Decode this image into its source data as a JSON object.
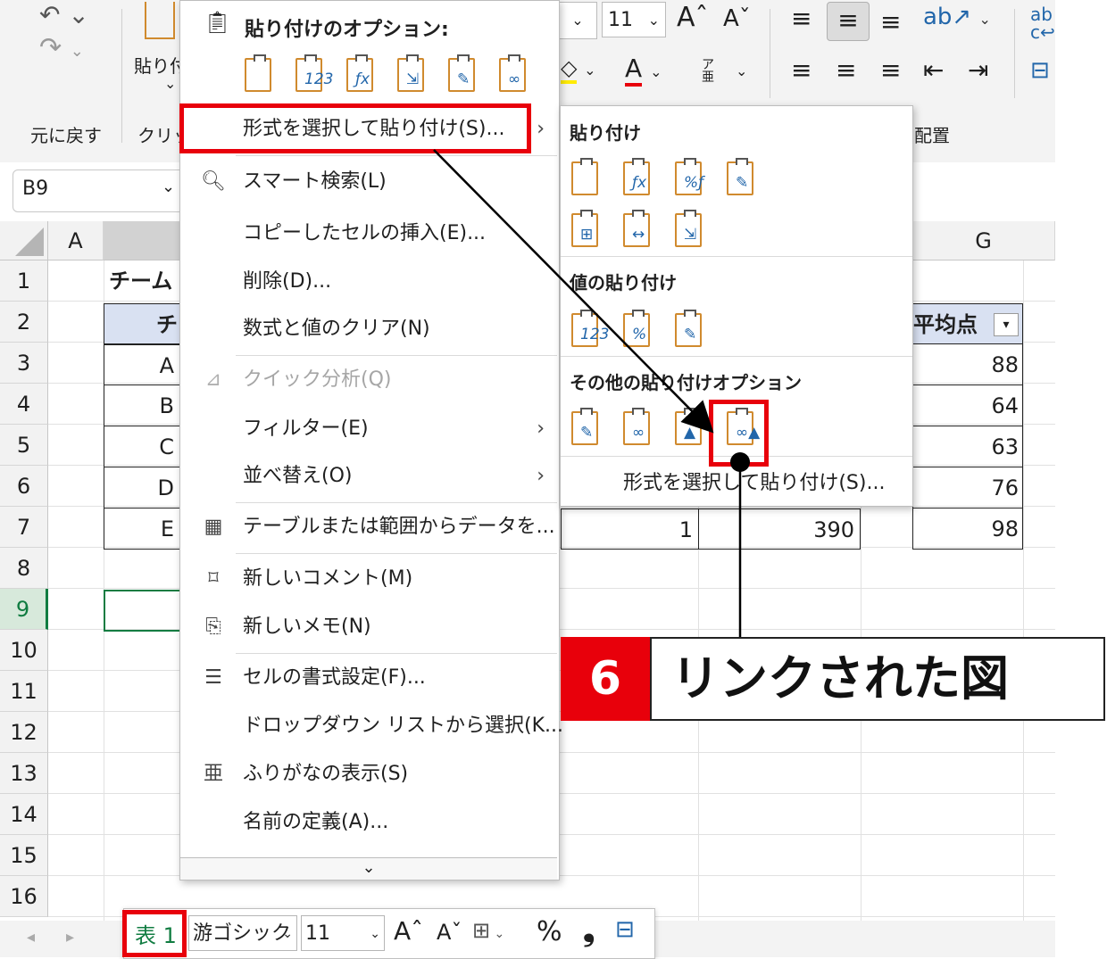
{
  "ribbon": {
    "undo_label": "元に戻す",
    "clipboard_label": "クリッ",
    "paste_partial": "貼り付",
    "font_size": "11",
    "align_label": "配置"
  },
  "namebox": {
    "value": "B9"
  },
  "columns": [
    "A",
    "G"
  ],
  "rows": [
    "1",
    "2",
    "3",
    "4",
    "5",
    "6",
    "7",
    "8",
    "9",
    "10",
    "11",
    "12",
    "13",
    "14",
    "15",
    "16"
  ],
  "sheet": {
    "title_partial": "チーム",
    "header_partial": "チ",
    "header_g": "平均点",
    "teams": [
      "A",
      "B",
      "C",
      "D",
      "E"
    ],
    "g_values": [
      "88",
      "64",
      "63",
      "76",
      "98"
    ],
    "row7_e": "1",
    "row7_f": "390"
  },
  "context_menu": {
    "paste_options_title": "貼り付けのオプション:",
    "items": [
      {
        "label": "形式を選択して貼り付け(S)...",
        "icon": "",
        "submenu": true
      },
      {
        "label": "スマート検索(L)",
        "icon": "search-info-icon"
      },
      {
        "label": "コピーしたセルの挿入(E)..."
      },
      {
        "label": "削除(D)..."
      },
      {
        "label": "数式と値のクリア(N)"
      },
      {
        "label": "クイック分析(Q)",
        "icon": "quick-analysis-icon",
        "disabled": true
      },
      {
        "label": "フィルター(E)",
        "submenu": true
      },
      {
        "label": "並べ替え(O)",
        "submenu": true
      },
      {
        "label": "テーブルまたは範囲からデータを...",
        "icon": "table-icon"
      },
      {
        "label": "新しいコメント(M)",
        "icon": "new-comment-icon"
      },
      {
        "label": "新しいメモ(N)",
        "icon": "new-note-icon"
      },
      {
        "label": "セルの書式設定(F)...",
        "icon": "format-cells-icon"
      },
      {
        "label": "ドロップダウン リストから選択(K..."
      },
      {
        "label": "ふりがなの表示(S)",
        "icon": "furigana-icon"
      },
      {
        "label": "名前の定義(A)..."
      }
    ],
    "more_glyph": "⌄"
  },
  "submenu": {
    "paste_title": "貼り付け",
    "values_title": "値の貼り付け",
    "other_title": "その他の貼り付けオプション",
    "footer": "形式を選択して貼り付け(S)..."
  },
  "annotation": {
    "step": "6",
    "label": "リンクされた図",
    "highlight_color": "#e8000b"
  },
  "mini_toolbar": {
    "sheet_tab": "表 1",
    "font": "游ゴシック",
    "size": "11",
    "percent": "%",
    "comma": "❟"
  }
}
